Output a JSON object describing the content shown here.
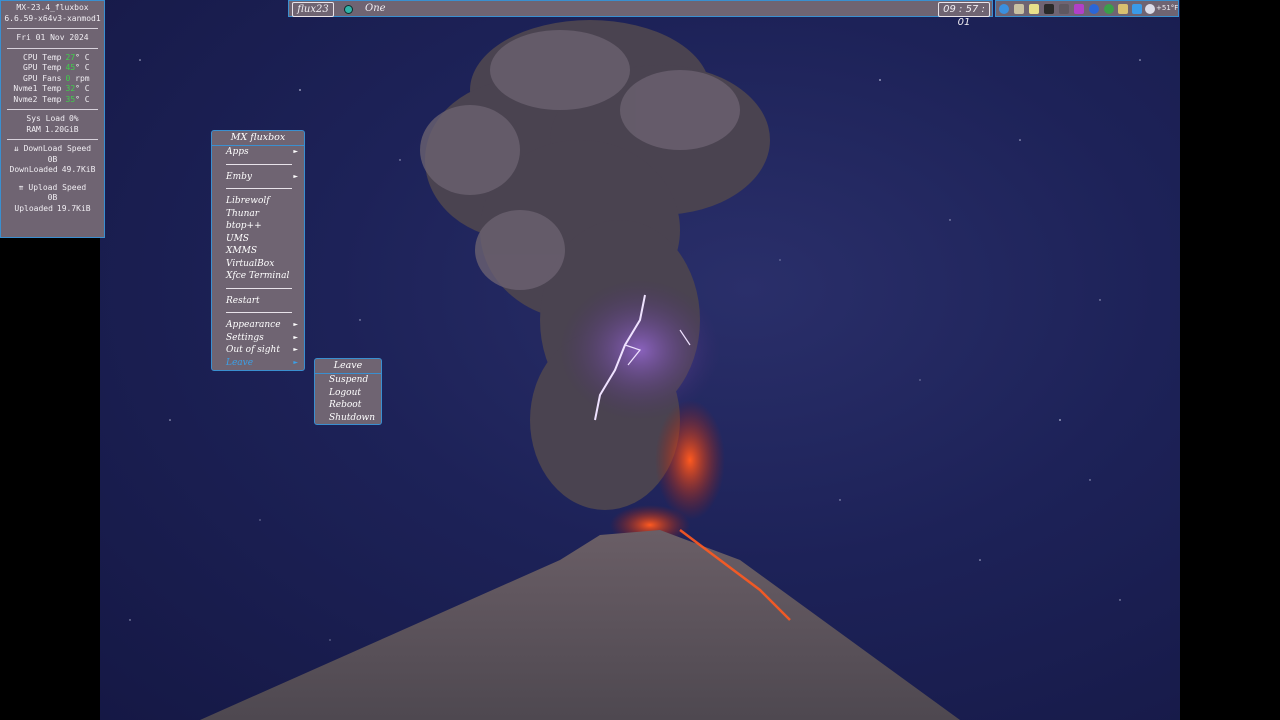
{
  "conky": {
    "distro": "MX-23.4_fluxbox",
    "kernel": "6.6.59-x64v3-xanmod1",
    "date": "Fri 01 Nov 2024",
    "sensors": [
      {
        "label": "CPU Temp",
        "value": "27",
        "unit": "° C"
      },
      {
        "label": "GPU Temp",
        "value": "45",
        "unit": "° C"
      },
      {
        "label": "GPU Fans",
        "value": "0",
        "unit": "rpm"
      },
      {
        "label": "Nvme1 Temp",
        "value": "32",
        "unit": "° C"
      },
      {
        "label": "Nvme2 Temp",
        "value": "35",
        "unit": "° C"
      }
    ],
    "sys_load_label": "Sys Load",
    "sys_load_value": "0%",
    "ram_label": "RAM",
    "ram_value": "1.20GiB",
    "download_speed_label": "⇊ DownLoad Speed",
    "download_speed_value": "0B",
    "downloaded_label": "DownLoaded",
    "downloaded_value": "49.7KiB",
    "upload_speed_label": "⇈ Upload Speed",
    "upload_speed_value": "0B",
    "uploaded_label": "Uploaded",
    "uploaded_value": "19.7KiB"
  },
  "toolbar": {
    "workspace_label": "flux23",
    "workspace_name": "One",
    "clock": "09 : 57 : 01"
  },
  "tray": {
    "icons": [
      "browser-icon",
      "files-icon",
      "editor-icon",
      "terminal-icon",
      "volume-icon",
      "media-icon",
      "network-icon",
      "update-icon",
      "clipboard-icon",
      "display-icon",
      "weather-icon"
    ],
    "temperature": "+51°F"
  },
  "root_menu": {
    "title": "MX fluxbox",
    "items": {
      "apps": "Apps",
      "emby": "Emby",
      "librewolf": "Librewolf",
      "thunar": "Thunar",
      "btop": "btop++",
      "ums": "UMS",
      "xmms": "XMMS",
      "virtualbox": "VirtualBox",
      "xfce_terminal": "Xfce Terminal",
      "restart": "Restart",
      "appearance": "Appearance",
      "settings": "Settings",
      "out_of_sight": "Out of sight",
      "leave": "Leave"
    },
    "arrow": "►"
  },
  "leave_menu": {
    "title": "Leave",
    "items": {
      "suspend": "Suspend",
      "logout": "Logout",
      "reboot": "Reboot",
      "shutdown": "Shutdown"
    }
  },
  "colors": {
    "panel_bg": "#6f6472",
    "border": "#3a8fd0",
    "accent_green": "#3fd04a",
    "active_item": "#3aa0e8"
  }
}
